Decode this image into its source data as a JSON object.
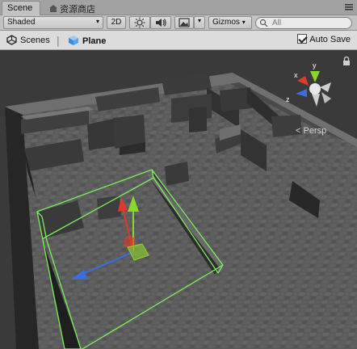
{
  "tabs": {
    "scene": "Scene",
    "asset_store": "资源商店"
  },
  "toolbar": {
    "shading_mode": "Shaded",
    "mode_2d": "2D",
    "gizmos": "Gizmos",
    "search_placeholder": "All"
  },
  "breadcrumb": {
    "root": "Scenes",
    "current": "Plane"
  },
  "auto_save": {
    "label": "Auto Save",
    "checked": true
  },
  "orientation_gizmo": {
    "projection": "Persp",
    "axes": [
      "x",
      "y",
      "z"
    ]
  },
  "colors": {
    "x_axis": "#e03a2a",
    "y_axis": "#8bd62a",
    "z_axis": "#3a6ee0",
    "selection_outline": "#7cf05a",
    "viewport_grid": "#6a6a6a"
  },
  "icons": [
    "scene-icon",
    "shop-icon",
    "panel-menu-icon",
    "sun-icon",
    "audio-icon",
    "image-effects-icon",
    "search-icon",
    "unity-logo-icon",
    "cube-icon",
    "lock-icon"
  ]
}
